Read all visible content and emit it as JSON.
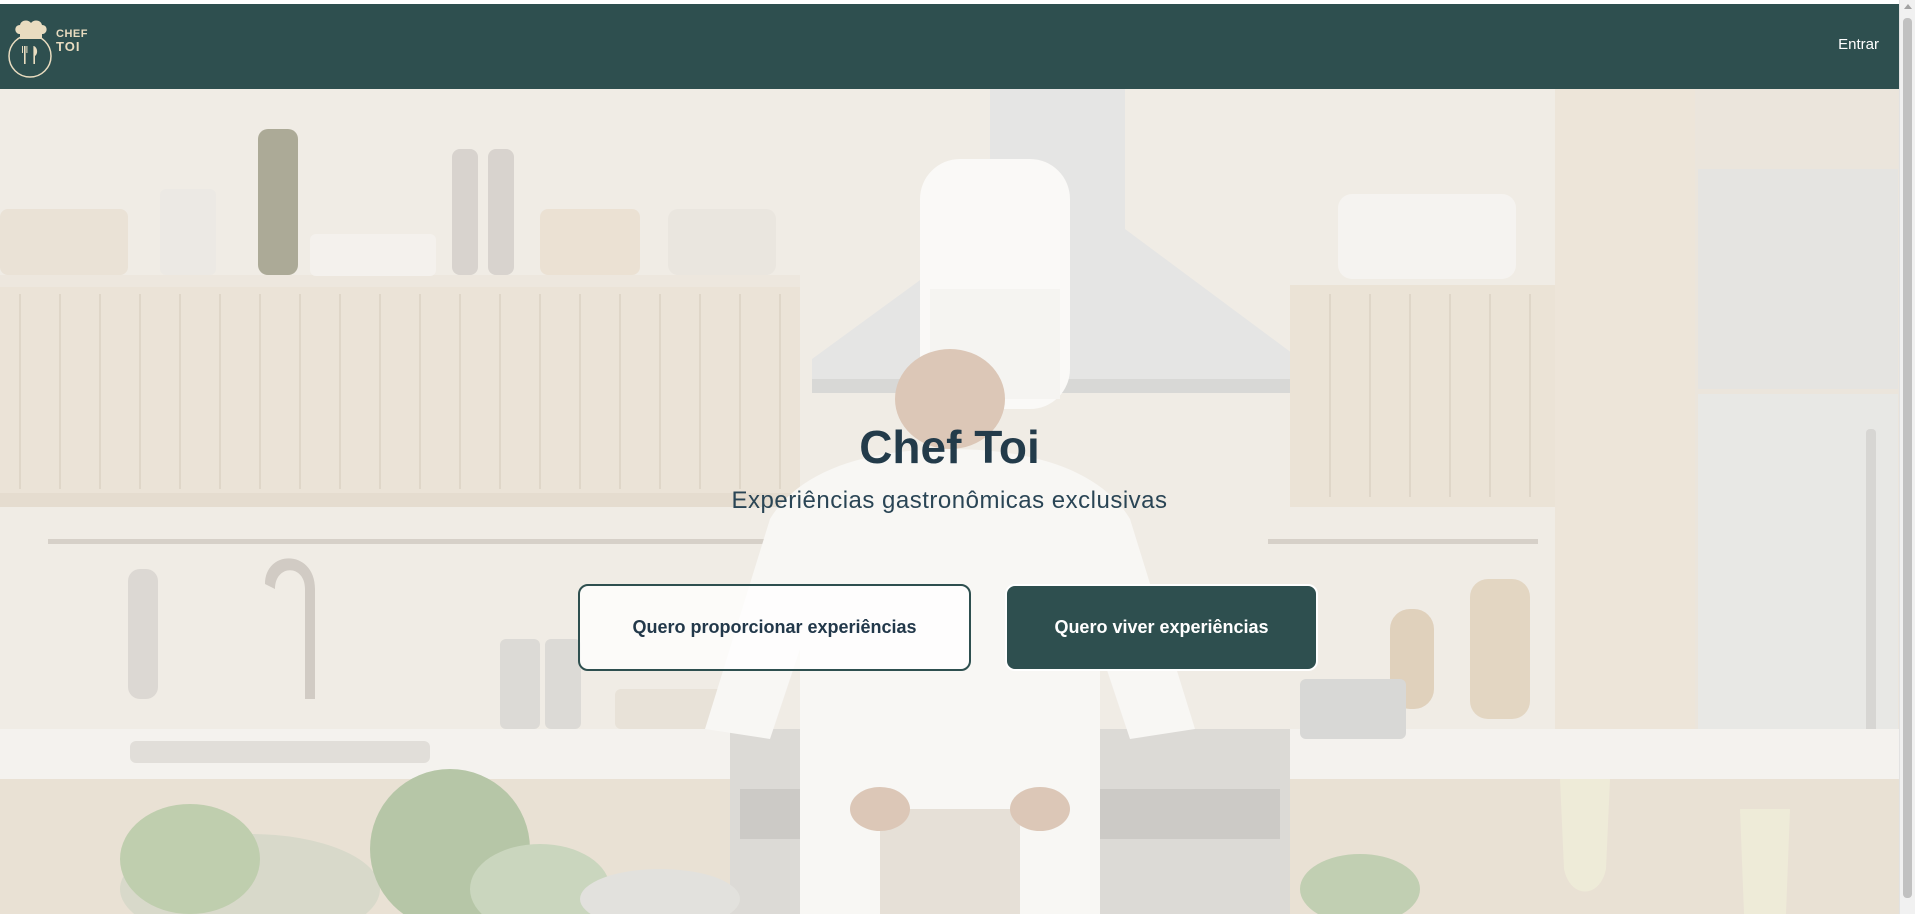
{
  "brand": {
    "line1": "CHEF",
    "line2": "TOI"
  },
  "nav": {
    "login_label": "Entrar"
  },
  "hero": {
    "title": "Chef Toi",
    "subtitle": "Experiências gastronômicas exclusivas",
    "primary_button": "Quero proporcionar experiências",
    "secondary_button": "Quero viver experiências"
  },
  "colors": {
    "nav_bg": "#2e4f4f",
    "accent_text": "#233b4a",
    "logo_gold": "#e9dcc0"
  }
}
